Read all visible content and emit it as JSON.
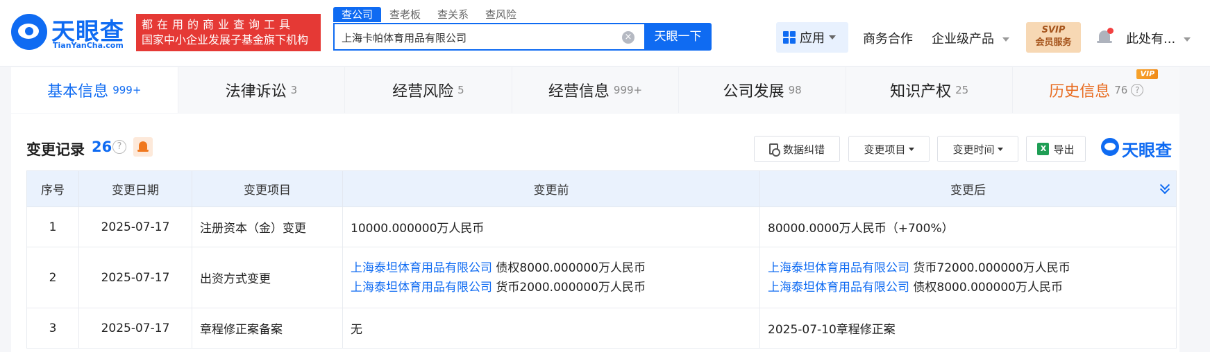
{
  "header": {
    "logo_cn": "天眼查",
    "logo_en": "TianYanCha.com",
    "slogan_line1": "都在用的商业查询工具",
    "slogan_line2": "国家中小企业发展子基金旗下机构",
    "search_tabs": [
      "查公司",
      "查老板",
      "查关系",
      "查风险"
    ],
    "search_value": "上海卡帕体育用品有限公司",
    "search_button": "天眼一下",
    "nav": {
      "apps": "应用",
      "business": "商务合作",
      "enterprise": "企业级产品",
      "svip_line1": "SVIP",
      "svip_line2": "会员服务",
      "user": "此处有..."
    }
  },
  "category_tabs": [
    {
      "label": "基本信息",
      "count": "999+"
    },
    {
      "label": "法律诉讼",
      "count": "3"
    },
    {
      "label": "经营风险",
      "count": "5"
    },
    {
      "label": "经营信息",
      "count": "999+"
    },
    {
      "label": "公司发展",
      "count": "98"
    },
    {
      "label": "知识产权",
      "count": "25"
    },
    {
      "label": "历史信息",
      "count": "76",
      "badge": "VIP"
    }
  ],
  "section": {
    "title": "变更记录",
    "count": "26",
    "tools": {
      "correct": "数据纠错",
      "change_item": "变更项目",
      "change_time": "变更时间",
      "export": "导出"
    },
    "watermark": "天眼查"
  },
  "table": {
    "headers": [
      "序号",
      "变更日期",
      "变更项目",
      "变更前",
      "变更后"
    ],
    "rows": [
      {
        "no": "1",
        "date": "2025-07-17",
        "item": "注册资本（金）变更",
        "before": "10000.000000万人民币",
        "after": "80000.0000万人民币（+700%）"
      },
      {
        "no": "2",
        "date": "2025-07-17",
        "item": "出资方式变更",
        "before_1_company": "上海泰坦体育用品有限公司",
        "before_1_text": "债权8000.000000万人民币",
        "before_2_company": "上海泰坦体育用品有限公司",
        "before_2_text": "货币2000.000000万人民币",
        "after_1_company": "上海泰坦体育用品有限公司",
        "after_1_text": "货币72000.000000万人民币",
        "after_2_company": "上海泰坦体育用品有限公司",
        "after_2_text": "债权8000.000000万人民币"
      },
      {
        "no": "3",
        "date": "2025-07-17",
        "item": "章程修正案备案",
        "before": "无",
        "after": "2025-07-10章程修正案"
      }
    ]
  },
  "colors": {
    "brand": "#0f6bf2",
    "slogan_bg": "#e53935",
    "history_tab": "#e86b1f",
    "change_after": "#e54b3c"
  }
}
